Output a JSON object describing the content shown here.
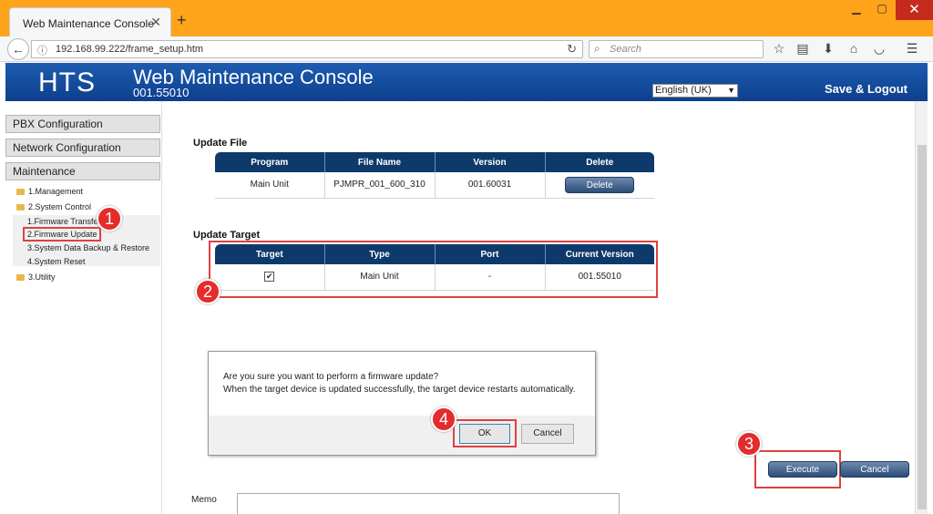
{
  "browser": {
    "tab_title": "Web Maintenance Console",
    "url": "192.168.99.222/frame_setup.htm",
    "search_placeholder": "Search"
  },
  "header": {
    "logo": "HTS",
    "title": "Web Maintenance Console",
    "version": "001.55010",
    "language": "English (UK)",
    "save_logout": "Save & Logout"
  },
  "sidebar": {
    "buttons": [
      "PBX Configuration",
      "Network Configuration",
      "Maintenance"
    ],
    "tree": {
      "management": "1.Management",
      "system_control": "2.System Control",
      "sub_items": [
        "1.Firmware Transfer",
        "2.Firmware Update",
        "3.System Data Backup & Restore",
        "4.System Reset"
      ],
      "utility": "3.Utility"
    }
  },
  "update_file": {
    "title": "Update File",
    "headers": [
      "Program",
      "File Name",
      "Version",
      "Delete"
    ],
    "row": {
      "program": "Main Unit",
      "file_name": "PJMPR_001_600_310",
      "version": "001.60031",
      "delete_label": "Delete"
    }
  },
  "update_target": {
    "title": "Update Target",
    "headers": [
      "Target",
      "Type",
      "Port",
      "Current Version"
    ],
    "row": {
      "target_checked": true,
      "target_mark": "✔",
      "type": "Main Unit",
      "port": "-",
      "current_version": "001.55010"
    }
  },
  "dialog": {
    "line1": "Are you sure you want to perform a firmware update?",
    "line2": "When the target device is updated successfully, the target device restarts automatically.",
    "ok": "OK",
    "cancel": "Cancel"
  },
  "actions": {
    "execute": "Execute",
    "cancel": "Cancel"
  },
  "memo_label": "Memo",
  "callouts": [
    "1",
    "2",
    "3",
    "4"
  ],
  "colors": {
    "tabbar": "#ffa31a",
    "header": "#0d3f8d",
    "table_header": "#0e3a6b",
    "callout": "#e52b2b"
  }
}
